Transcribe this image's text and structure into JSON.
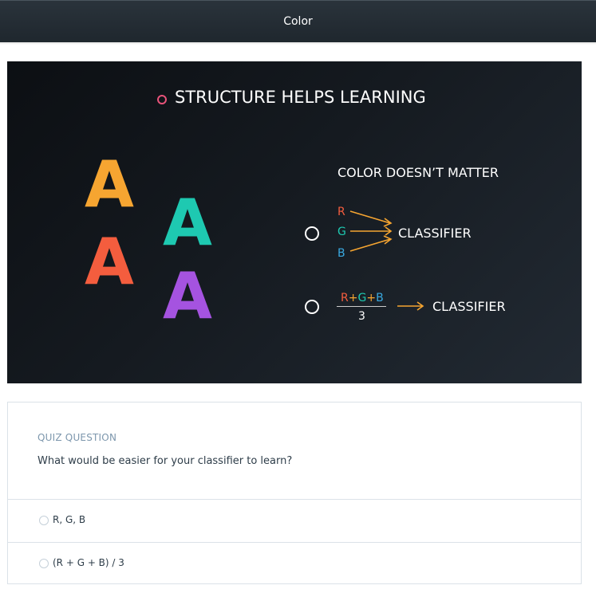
{
  "header": {
    "title": "Color"
  },
  "slide": {
    "heading": "STRUCTURE HELPS LEARNING",
    "letters": [
      "A",
      "A",
      "A",
      "A"
    ],
    "subheading": "COLOR DOESN’T MATTER",
    "option1": {
      "channels": [
        "R",
        "G",
        "B"
      ],
      "target": "CLASSIFIER"
    },
    "option2": {
      "numerator": {
        "r": "R",
        "plus1": "+",
        "g": "G",
        "plus2": "+",
        "b": "B"
      },
      "denominator": "3",
      "target": "CLASSIFIER"
    },
    "colors": {
      "orange": "#f6a531",
      "red": "#f45d3e",
      "teal": "#1ec9b1",
      "purple": "#a553e0",
      "blue": "#39a9e0",
      "pink": "#e8537a"
    }
  },
  "quiz": {
    "label": "QUIZ QUESTION",
    "question": "What would be easier for your classifier to learn?",
    "options": [
      {
        "label": "R, G, B"
      },
      {
        "label": "(R + G + B) / 3"
      }
    ]
  }
}
